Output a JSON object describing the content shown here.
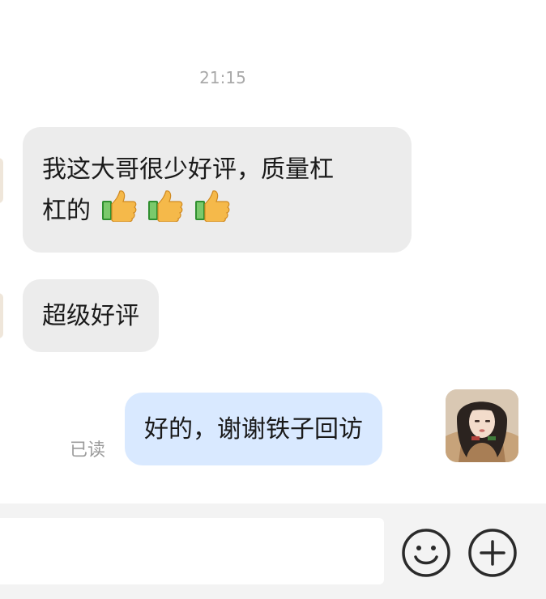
{
  "chat": {
    "timestamp": "21:15",
    "messages": [
      {
        "line1": "我这大哥很少好评，质量杠",
        "line2": "杠的",
        "emoji": [
          "thumbs-up-icon",
          "thumbs-up-icon",
          "thumbs-up-icon"
        ]
      },
      {
        "text": "超级好评"
      },
      {
        "text": "好的，谢谢铁子回访",
        "status": "已读"
      }
    ]
  },
  "footer": {
    "input_placeholder": "",
    "icons": [
      "emoji-icon",
      "plus-icon"
    ]
  }
}
